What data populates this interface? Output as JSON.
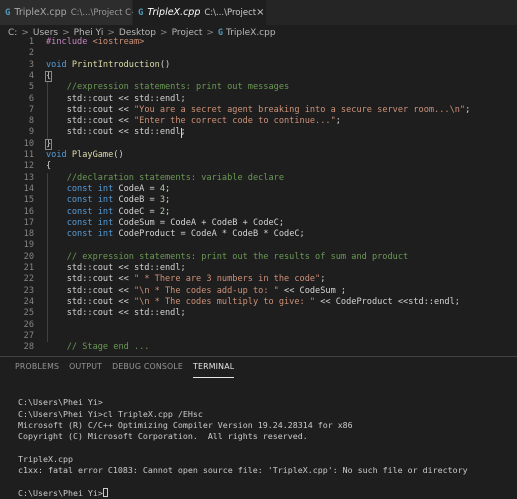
{
  "tabs": [
    {
      "name": "TripleX.cpp",
      "path": "C:\\...\\Project C++",
      "active": false
    },
    {
      "name": "TripleX.cpp",
      "path": "C:\\...\\Project",
      "active": true
    }
  ],
  "file_type_glyph": "G",
  "close_glyph": "×",
  "breadcrumb": [
    "C:",
    "Users",
    "Phei Yi",
    "Desktop",
    "Project",
    "TripleX.cpp"
  ],
  "breadcrumb_sep": ">",
  "editor": {
    "lines": [
      {
        "n": "1",
        "tokens": [
          [
            "pp",
            "#include "
          ],
          [
            "inc",
            "<iostream>"
          ]
        ]
      },
      {
        "n": "2",
        "tokens": []
      },
      {
        "n": "3",
        "tokens": [
          [
            "kw",
            "void "
          ],
          [
            "fn",
            "PrintIntroduction"
          ],
          [
            "plain",
            "()"
          ]
        ]
      },
      {
        "n": "4",
        "tokens": [
          [
            "plain",
            "{"
          ]
        ]
      },
      {
        "n": "5",
        "tokens": [
          [
            "plain",
            "    "
          ],
          [
            "cm",
            "//expression statements: print out messages"
          ]
        ]
      },
      {
        "n": "6",
        "tokens": [
          [
            "plain",
            "    std::cout << std::endl;"
          ]
        ]
      },
      {
        "n": "7",
        "tokens": [
          [
            "plain",
            "    std::cout << "
          ],
          [
            "str",
            "\"You are a secret agent breaking into a secure server room...\\n\""
          ],
          [
            "plain",
            ";"
          ]
        ]
      },
      {
        "n": "8",
        "tokens": [
          [
            "plain",
            "    std::cout << "
          ],
          [
            "str",
            "\"Enter the correct code to continue...\""
          ],
          [
            "plain",
            ";"
          ]
        ]
      },
      {
        "n": "9",
        "tokens": [
          [
            "plain",
            "    std::cout << std::endl;"
          ]
        ]
      },
      {
        "n": "10",
        "tokens": [
          [
            "plain",
            "}"
          ]
        ]
      },
      {
        "n": "11",
        "tokens": [
          [
            "kw",
            "void "
          ],
          [
            "fn",
            "PlayGame"
          ],
          [
            "plain",
            "()"
          ]
        ]
      },
      {
        "n": "12",
        "tokens": [
          [
            "plain",
            "{"
          ]
        ]
      },
      {
        "n": "13",
        "tokens": [
          [
            "plain",
            "    "
          ],
          [
            "cm",
            "//declaration statements: variable declare"
          ]
        ]
      },
      {
        "n": "14",
        "tokens": [
          [
            "plain",
            "    "
          ],
          [
            "kw",
            "const int "
          ],
          [
            "plain",
            "CodeA = "
          ],
          [
            "num",
            "4"
          ],
          [
            "plain",
            ";"
          ]
        ]
      },
      {
        "n": "15",
        "tokens": [
          [
            "plain",
            "    "
          ],
          [
            "kw",
            "const int "
          ],
          [
            "plain",
            "CodeB = "
          ],
          [
            "num",
            "3"
          ],
          [
            "plain",
            ";"
          ]
        ]
      },
      {
        "n": "16",
        "tokens": [
          [
            "plain",
            "    "
          ],
          [
            "kw",
            "const int "
          ],
          [
            "plain",
            "CodeC = "
          ],
          [
            "num",
            "2"
          ],
          [
            "plain",
            ";"
          ]
        ]
      },
      {
        "n": "17",
        "tokens": [
          [
            "plain",
            "    "
          ],
          [
            "kw",
            "const int "
          ],
          [
            "plain",
            "CodeSum = CodeA + CodeB + CodeC;"
          ]
        ]
      },
      {
        "n": "18",
        "tokens": [
          [
            "plain",
            "    "
          ],
          [
            "kw",
            "const int "
          ],
          [
            "plain",
            "CodeProduct = CodeA * CodeB * CodeC;"
          ]
        ]
      },
      {
        "n": "19",
        "tokens": []
      },
      {
        "n": "20",
        "tokens": [
          [
            "plain",
            "    "
          ],
          [
            "cm",
            "// expression statements: print out the results of sum and product"
          ]
        ]
      },
      {
        "n": "21",
        "tokens": [
          [
            "plain",
            "    std::cout << std::endl;"
          ]
        ]
      },
      {
        "n": "22",
        "tokens": [
          [
            "plain",
            "    std::cout << "
          ],
          [
            "str",
            "\" * There are 3 numbers in the code\""
          ],
          [
            "plain",
            ";"
          ]
        ]
      },
      {
        "n": "23",
        "tokens": [
          [
            "plain",
            "    std::cout << "
          ],
          [
            "str",
            "\"\\n * The codes add-up to: \""
          ],
          [
            "plain",
            " << CodeSum ;"
          ]
        ]
      },
      {
        "n": "24",
        "tokens": [
          [
            "plain",
            "    std::cout << "
          ],
          [
            "str",
            "\"\\n * The codes multiply to give: \""
          ],
          [
            "plain",
            " << CodeProduct <<std::endl;"
          ]
        ]
      },
      {
        "n": "25",
        "tokens": [
          [
            "plain",
            "    std::cout << std::endl;"
          ]
        ]
      },
      {
        "n": "26",
        "tokens": []
      },
      {
        "n": "27",
        "tokens": []
      },
      {
        "n": "28",
        "tokens": [
          [
            "plain",
            "    "
          ],
          [
            "cm",
            "// Stage end ..."
          ]
        ]
      }
    ]
  },
  "panel": {
    "tabs": [
      "PROBLEMS",
      "OUTPUT",
      "DEBUG CONSOLE",
      "TERMINAL"
    ],
    "active_tab": "TERMINAL"
  },
  "terminal": {
    "lines": [
      "",
      "C:\\Users\\Phei Yi>",
      "C:\\Users\\Phei Yi>cl TripleX.cpp /EHsc",
      "Microsoft (R) C/C++ Optimizing Compiler Version 19.24.28314 for x86",
      "Copyright (C) Microsoft Corporation.  All rights reserved.",
      "",
      "TripleX.cpp",
      "c1xx: fatal error C1083: Cannot open source file: 'TripleX.cpp': No such file or directory",
      "",
      "C:\\Users\\Phei Yi>"
    ]
  }
}
